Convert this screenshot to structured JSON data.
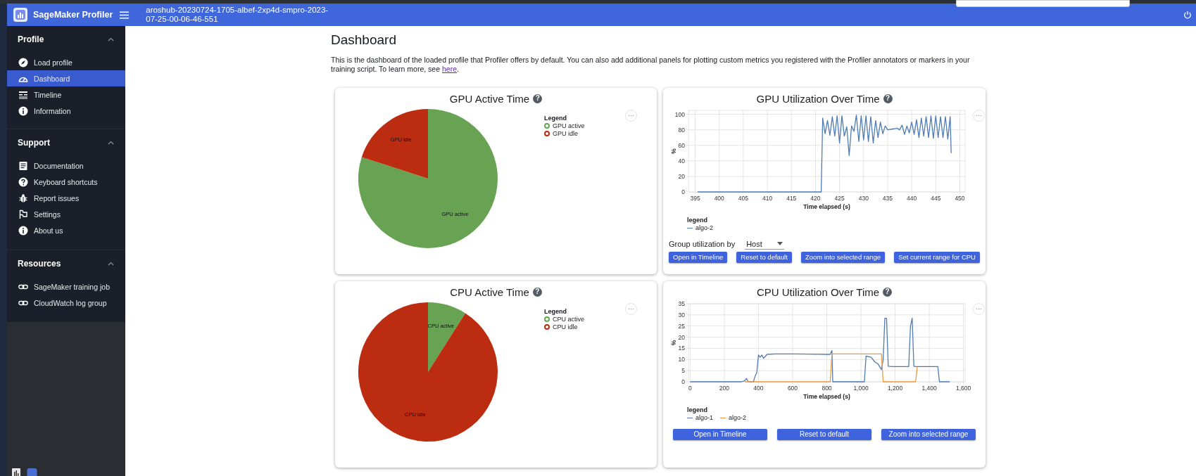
{
  "app": {
    "name": "SageMaker Profiler"
  },
  "header": {
    "title": "aroshub-20230724-1705-albef-2xp4d-smpro-2023-07-25-00-06-46-551"
  },
  "sidebar": {
    "sections": [
      {
        "title": "Profile",
        "expanded": true,
        "items": [
          {
            "label": "Load profile",
            "selected": false
          },
          {
            "label": "Dashboard",
            "selected": true
          },
          {
            "label": "Timeline",
            "selected": false
          },
          {
            "label": "Information",
            "selected": false
          }
        ]
      },
      {
        "title": "Support",
        "expanded": true,
        "items": [
          {
            "label": "Documentation",
            "selected": false
          },
          {
            "label": "Keyboard shortcuts",
            "selected": false
          },
          {
            "label": "Report issues",
            "selected": false
          },
          {
            "label": "Settings",
            "selected": false
          },
          {
            "label": "About us",
            "selected": false
          }
        ]
      },
      {
        "title": "Resources",
        "expanded": true,
        "items": [
          {
            "label": "SageMaker training job",
            "selected": false
          },
          {
            "label": "CloudWatch log group",
            "selected": false
          }
        ]
      }
    ]
  },
  "page": {
    "title": "Dashboard",
    "description": {
      "text": "This is the dashboard of the loaded profile that Profiler offers by default. You can also add additional panels for plotting custom metrics you registered with the Profiler annotators or markers in your training script. To learn more, see ",
      "link": "here",
      "end": "."
    }
  },
  "panels": [
    {
      "kind": "pie",
      "title": "GPU Active Time",
      "help": "?",
      "legend": {
        "title": "Legend",
        "items": [
          {
            "label": "GPU active",
            "color": "#67a353"
          },
          {
            "label": "GPU idle",
            "color": "#bb2c10"
          }
        ]
      },
      "chart_data": {
        "type": "pie",
        "categories": [
          "GPU active",
          "GPU idle"
        ],
        "values": [
          80,
          20
        ]
      }
    },
    {
      "kind": "line",
      "title": "GPU Utilization Over Time",
      "help": "?",
      "legend_title": "legend",
      "group_by": {
        "label": "Group utilization by",
        "value": "Host"
      },
      "buttons": [
        "Open in Timeline",
        "Reset to default",
        "Zoom into selected range",
        "Set current range for CPU"
      ],
      "chart_data": {
        "type": "line",
        "grid": true,
        "xlabel": "Time elapsed (s)",
        "ylabel": "%",
        "xlim": [
          393.6,
          451.1
        ],
        "ylim": [
          0,
          105
        ],
        "xticks": [
          395,
          400,
          405,
          410,
          415,
          420,
          425,
          430,
          435,
          440,
          445,
          450
        ],
        "yticks": [
          0,
          20,
          40,
          60,
          80,
          100
        ],
        "x": [
          395.5,
          421.2,
          421.5,
          422,
          422.5,
          423,
          423.5,
          424,
          424.5,
          425,
          425.5,
          426,
          426.5,
          427,
          427.5,
          428,
          428.5,
          429,
          429.5,
          430,
          430.5,
          431,
          431.5,
          432,
          432.5,
          433,
          433.5,
          434,
          434.5,
          435,
          436,
          437,
          437.5,
          438,
          438.5,
          439,
          439.5,
          440,
          440.5,
          441,
          441.5,
          442,
          442.5,
          443,
          443.5,
          444,
          444.5,
          445,
          445.5,
          446,
          446.5,
          447,
          447.5,
          448,
          448.2
        ],
        "series": [
          {
            "name": "algo-2",
            "color": "#4f7cb6",
            "values": [
              0,
              0,
              95,
              75,
              92,
              73,
              97,
              72,
              98,
              63,
              98,
              72,
              84,
              47,
              85,
              78,
              99,
              65,
              98,
              67,
              98,
              65,
              97,
              63,
              92,
              70,
              90,
              75,
              85,
              80,
              81,
              82,
              80,
              86,
              74,
              85,
              76,
              90,
              74,
              93,
              70,
              95,
              72,
              97,
              70,
              98,
              69,
              98,
              70,
              97,
              70,
              97,
              68,
              97,
              50
            ]
          }
        ]
      }
    },
    {
      "kind": "pie",
      "title": "CPU Active Time",
      "help": "?",
      "legend": {
        "title": "Legend",
        "items": [
          {
            "label": "CPU active",
            "color": "#67a353"
          },
          {
            "label": "CPU idle",
            "color": "#bb2c10"
          }
        ]
      },
      "chart_data": {
        "type": "pie",
        "categories": [
          "CPU active",
          "CPU idle"
        ],
        "values": [
          9,
          91
        ]
      }
    },
    {
      "kind": "line",
      "title": "CPU Utilization Over Time",
      "help": "?",
      "legend_title": "legend",
      "buttons": [
        "Open in Timeline",
        "Reset to default",
        "Zoom into selected range"
      ],
      "chart_data": {
        "type": "line",
        "grid": true,
        "xlabel": "Time elapsed (s)",
        "ylabel": "%",
        "xlim": [
          -10,
          1610
        ],
        "ylim": [
          0,
          35
        ],
        "xticks": [
          0,
          200,
          400,
          600,
          800,
          {
            "value": 1000,
            "label": "1,000"
          },
          {
            "value": 1200,
            "label": "1,200"
          },
          {
            "value": 1400,
            "label": "1,400"
          },
          {
            "value": 1600,
            "label": "1,600"
          }
        ],
        "yticks": [
          0,
          5,
          10,
          15,
          20,
          25,
          30,
          35
        ],
        "x": [
          0,
          300,
          320,
          330,
          340,
          370,
          380,
          390,
          400,
          410,
          420,
          430,
          450,
          500,
          600,
          700,
          800,
          820,
          830,
          835,
          840,
          1020,
          1030,
          1060,
          1080,
          1100,
          1120,
          1130,
          1140,
          1150,
          1160,
          1180,
          1280,
          1290,
          1300,
          1310,
          1320,
          1330,
          1400,
          1450,
          1460,
          1470,
          1520
        ],
        "series": [
          {
            "name": "algo-1",
            "color": "#4f7cb6",
            "values": [
              0,
              0,
              0.5,
              1.5,
              0,
              0,
              2.5,
              4,
              12,
              11,
              12,
              10.5,
              12.3,
              12.5,
              12.5,
              12.4,
              12.3,
              12.3,
              14,
              0,
              0,
              0,
              11.5,
              11,
              9,
              8,
              5.5,
              10,
              28.5,
              28.5,
              7,
              6.8,
              6.8,
              25,
              28.5,
              7,
              6.8,
              6.8,
              6.8,
              6.8,
              0,
              0,
              0
            ]
          },
          {
            "name": "algo-2",
            "color": "#f5993b",
            "values": [
              null,
              null,
              0,
              0,
              0,
              0,
              0,
              0,
              0,
              0,
              0,
              0,
              0,
              0,
              0,
              0,
              0,
              0,
              12.5,
              12.5,
              12.5,
              12.5,
              12.5,
              12.5,
              12.5,
              12.5,
              12.5,
              0,
              0,
              0,
              0,
              0,
              0,
              0,
              0,
              0,
              0,
              6.8,
              null,
              null,
              null,
              null,
              null
            ]
          }
        ]
      }
    }
  ]
}
